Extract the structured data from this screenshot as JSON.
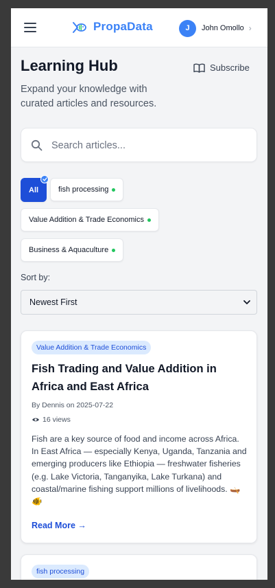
{
  "header": {
    "app_name": "PropaData",
    "user_initial": "J",
    "user_name": "John Omollo",
    "user_chevron": "›"
  },
  "page": {
    "title": "Learning Hub",
    "subscribe_label": "Subscribe",
    "subtitle": "Expand your knowledge with curated articles and resources."
  },
  "search": {
    "placeholder": "Search articles...",
    "value": ""
  },
  "filters": [
    {
      "label": "All",
      "selected": true
    },
    {
      "label": "fish processing",
      "selected": false
    },
    {
      "label": "Value Addition & Trade Economics",
      "selected": false
    },
    {
      "label": "Business & Aquaculture",
      "selected": false
    }
  ],
  "sort": {
    "label": "Sort by:",
    "selected": "Newest First"
  },
  "articles": [
    {
      "category": "Value Addition & Trade Economics",
      "title": "Fish Trading and Value Addition in Africa and East Africa",
      "meta": "By Dennis on 2025-07-22",
      "views": "16 views",
      "excerpt": "Fish are a key source of food and income across Africa. In East Africa — especially Kenya, Uganda, Tanzania and emerging producers like Ethiopia — freshwater fisheries (e.g. Lake Victoria, Tanganyika, Lake Turkana) and coastal/marine fishing support millions of livelihoods. 🛶🐠",
      "read_more": "Read More →"
    },
    {
      "category": "fish processing"
    }
  ],
  "colors": {
    "accent": "#3b82f6",
    "primary_dark": "#1d4ed8",
    "tag_bg": "#dbeafe",
    "status_dot": "#22c55e",
    "page_bg": "#f3f4f6"
  }
}
